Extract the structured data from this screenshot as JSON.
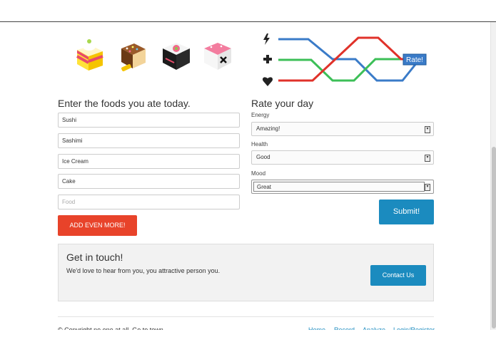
{
  "food_section": {
    "title": "Enter the foods you ate today.",
    "foods": [
      "Sushi",
      "Sashimi",
      "Ice Cream",
      "Cake"
    ],
    "food_placeholder": "Food",
    "add_button": "ADD EVEN MORE!",
    "icons": [
      "cake-icon",
      "ice-cream-icon",
      "sushi-icon",
      "sashimi-icon"
    ]
  },
  "rate_section": {
    "title": "Rate your day",
    "fields": [
      {
        "label": "Energy",
        "value": "Amazing!"
      },
      {
        "label": "Health",
        "value": "Good"
      },
      {
        "label": "Mood",
        "value": "Great"
      }
    ],
    "submit_button": "Submit!",
    "legend_icons": [
      "lightning-icon",
      "plus-icon",
      "heart-icon"
    ],
    "rate_badge": "Rate!",
    "line_colors": {
      "energy": "#3a7bc8",
      "health": "#3cbf57",
      "mood": "#e0322a"
    }
  },
  "contact": {
    "title": "Get in touch!",
    "text": "We'd love to hear from you, you attractive person you.",
    "button": "Contact Us"
  },
  "footer": {
    "copyright": "© Copyright no one at all. Go to town.",
    "links": [
      "Home",
      "Record",
      "Analyze",
      "Login/Register"
    ]
  },
  "colors": {
    "accent_red": "#e8432a",
    "accent_blue": "#1b8bbf"
  }
}
